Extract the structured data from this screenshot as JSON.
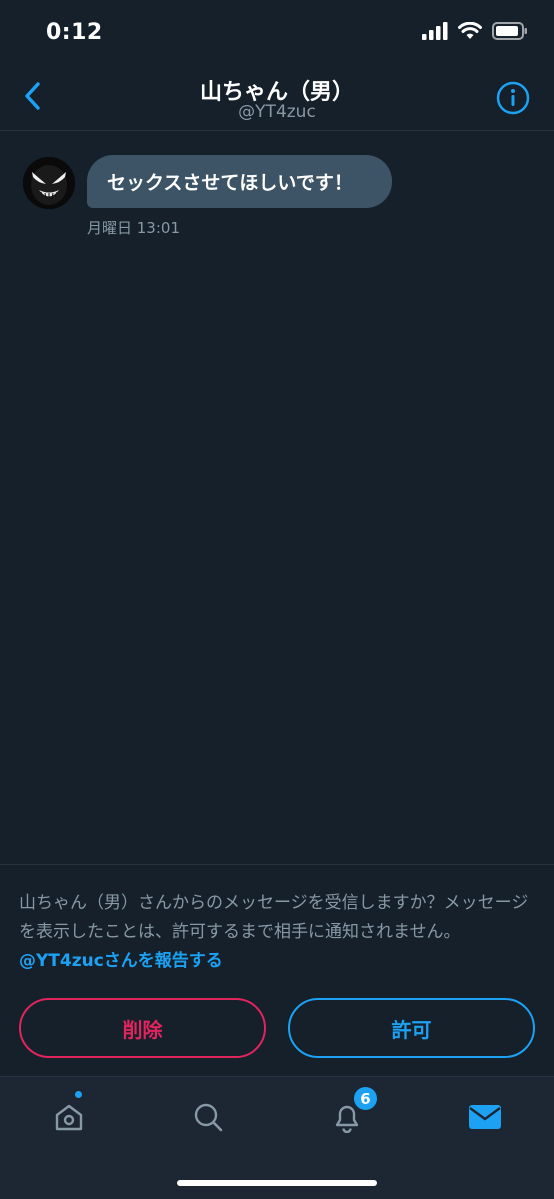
{
  "status_bar": {
    "time": "0:12",
    "icons": [
      "signal-icon",
      "wifi-icon",
      "battery-icon"
    ]
  },
  "header": {
    "title": "山ちゃん（男）",
    "handle": "@YT4zuc",
    "back_icon": "chevron-left-icon",
    "info_icon": "info-icon"
  },
  "conversation": {
    "messages": [
      {
        "text": "セックスさせてほしいです！",
        "timestamp": "月曜日 13:01",
        "avatar": "avatar"
      }
    ]
  },
  "request": {
    "prompt": "山ちゃん（男）さんからのメッセージを受信しますか？メッセージを表示したことは、許可するまで相手に通知されません。",
    "report_link": "@YT4zucさんを報告する",
    "delete_label": "削除",
    "allow_label": "許可"
  },
  "tab_bar": {
    "tabs": [
      "home-icon",
      "search-icon",
      "bell-icon",
      "mail-icon"
    ],
    "notification_count": "6"
  },
  "colors": {
    "background": "#15202b",
    "accent": "#1da1f2",
    "danger": "#e0245e",
    "bubble": "#3d5466",
    "muted": "#8899a6"
  }
}
